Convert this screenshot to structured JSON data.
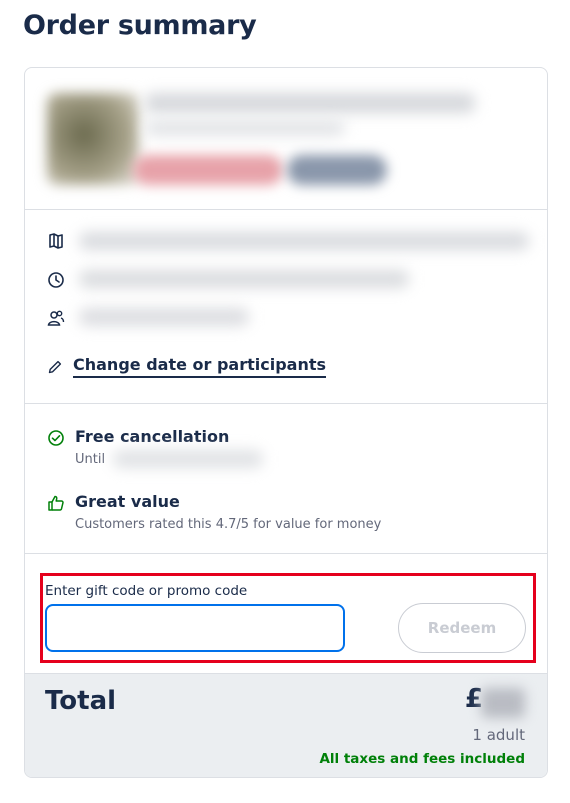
{
  "header": {
    "title": "Order summary"
  },
  "details": {
    "change_label": "Change date or participants",
    "icons": [
      "map-icon",
      "clock-icon",
      "participants-icon",
      "pencil-icon"
    ]
  },
  "benefits": {
    "free_cancellation": {
      "title": "Free cancellation",
      "subtitle": "Until"
    },
    "great_value": {
      "title": "Great value",
      "subtitle": "Customers rated this 4.7/5 for value for money"
    }
  },
  "promo": {
    "label": "Enter gift code or promo code",
    "value": "",
    "placeholder": "",
    "redeem_label": "Redeem"
  },
  "total": {
    "label": "Total",
    "currency": "£",
    "participants": "1 adult",
    "taxes_note": "All taxes and fees included"
  },
  "colors": {
    "primary_text": "#1a2b49",
    "accent_blue": "#0071eb",
    "success_green": "#008009",
    "highlight_red": "#e5001c"
  }
}
